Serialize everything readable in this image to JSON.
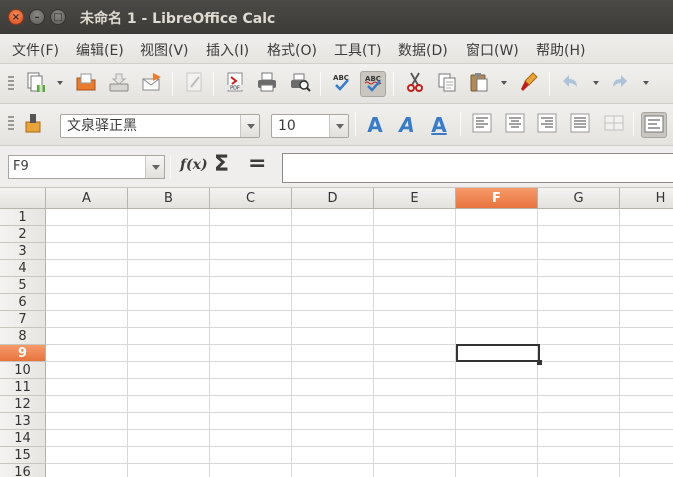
{
  "window": {
    "title": "未命名 1 - LibreOffice Calc",
    "close_glyph": "×",
    "minimize_glyph": "–",
    "maximize_glyph": "□"
  },
  "menu": [
    "文件(F)",
    "编辑(E)",
    "视图(V)",
    "插入(I)",
    "格式(O)",
    "工具(T)",
    "数据(D)",
    "窗口(W)",
    "帮助(H)"
  ],
  "toolbar": {
    "icons": [
      "new-icon",
      "open-icon",
      "save-icon",
      "send-icon",
      "edit-file-icon",
      "export-pdf-icon",
      "print-icon",
      "print-preview-icon",
      "spellcheck-icon",
      "autospellcheck-icon",
      "cut-icon",
      "copy-icon",
      "paste-icon",
      "clone-formatting-icon",
      "undo-icon",
      "redo-icon"
    ],
    "autospellcheck_active": true
  },
  "format_toolbar": {
    "font_name": "文泉驿正黑",
    "font_size": "10",
    "icons": [
      "font-color-icon",
      "bold-icon",
      "italic-icon",
      "underline-icon",
      "align-left-icon",
      "align-center-icon",
      "align-right-icon",
      "justify-icon",
      "merge-cells-icon",
      "wrap-text-icon"
    ],
    "font_a_glyph": "A"
  },
  "formula_bar": {
    "name_box": "F9",
    "function_wizard": "f(x)",
    "sum": "Σ",
    "equals": "=",
    "formula": ""
  },
  "sheet": {
    "columns": [
      "A",
      "B",
      "C",
      "D",
      "E",
      "F",
      "G",
      "H"
    ],
    "rows": [
      "1",
      "2",
      "3",
      "4",
      "5",
      "6",
      "7",
      "8",
      "9",
      "10",
      "11",
      "12",
      "13",
      "14",
      "15",
      "16"
    ],
    "selected_column": "F",
    "selected_row": "9"
  },
  "colors": {
    "accent": "#e8733d",
    "titlebar": "#3c3b37"
  }
}
